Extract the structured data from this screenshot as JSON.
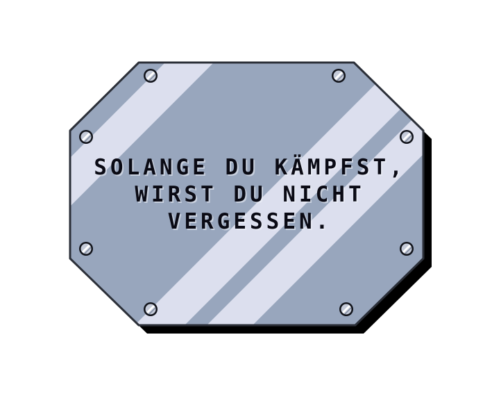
{
  "plaque": {
    "lines": [
      "SOLANGE DU KÄMPFST,",
      "WIRST DU NICHT",
      "VERGESSEN."
    ]
  },
  "colors": {
    "plate_fill": "#98a6bd",
    "plate_border": "#2b2f38",
    "shadow": "#000000",
    "highlight_stripe": "#dcdfee",
    "text": "#0a0a14",
    "rivet_fill": "#c4cad8"
  },
  "icons": {
    "rivet": "rivet-icon",
    "shine": "glare-stripe"
  }
}
